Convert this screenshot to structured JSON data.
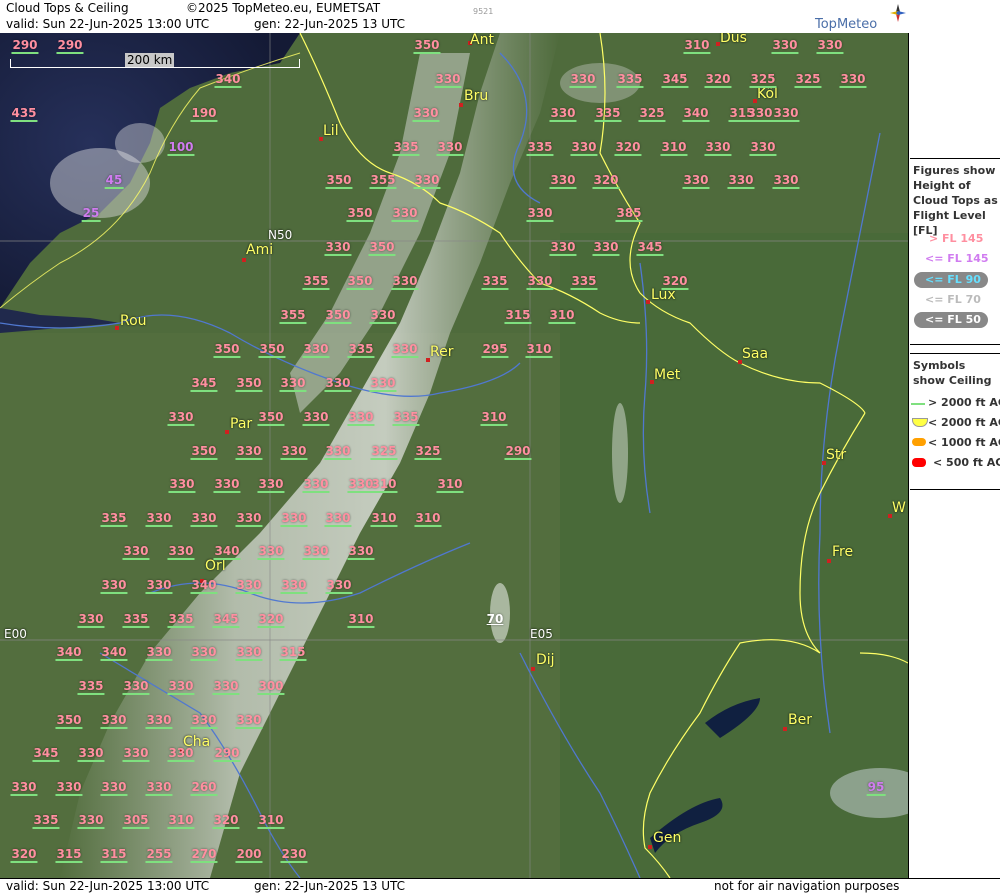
{
  "header": {
    "title": "Cloud Tops & Ceiling",
    "copyright": "©2025 TopMeteo.eu, EUMETSAT",
    "code": "9521",
    "valid": "valid:  Sun  22-Jun-2025  13:00 UTC",
    "gen": "gen: 22-Jun-2025 13 UTC",
    "logo": "TopMeteo"
  },
  "footer": {
    "valid": "valid:  Sun  22-Jun-2025  13:00 UTC",
    "gen": "gen: 22-Jun-2025 13 UTC",
    "disclaimer": "not for air navigation purposes"
  },
  "scale_bar": "200 km",
  "grid_labels": {
    "n50": "N50",
    "e00": "E00",
    "e05": "E05"
  },
  "cities": [
    "Ant",
    "Düs",
    "Bru",
    "Köl",
    "Lil",
    "Ami",
    "Rou",
    "Lux",
    "Rer",
    "Saa",
    "Met",
    "Par",
    "Str",
    "Fre",
    "W",
    "Orl",
    "Dij",
    "Ber",
    "Cha",
    "Gen"
  ],
  "cloud_labels": [
    "290",
    "290",
    "350",
    "310",
    "330",
    "330",
    "330",
    "330",
    "335",
    "345",
    "320",
    "325",
    "325",
    "330",
    "340",
    "435",
    "190",
    "330",
    "330",
    "335",
    "325",
    "340",
    "315",
    "330",
    "330",
    "100",
    "335",
    "330",
    "335",
    "330",
    "320",
    "310",
    "330",
    "330",
    "45",
    "350",
    "355",
    "330",
    "330",
    "320",
    "330",
    "330",
    "25",
    "330",
    "350",
    "330",
    "330",
    "385",
    "330",
    "350",
    "330",
    "330",
    "345",
    "355",
    "350",
    "330",
    "335",
    "330",
    "335",
    "355",
    "320",
    "350",
    "330",
    "330",
    "315",
    "310",
    "350",
    "350",
    "330",
    "335",
    "295",
    "310",
    "345",
    "350",
    "330",
    "330",
    "330",
    "330",
    "350",
    "330",
    "330",
    "335",
    "325",
    "310",
    "350",
    "330",
    "330",
    "330",
    "325",
    "310",
    "290",
    "330",
    "330",
    "330",
    "330",
    "330",
    "310",
    "335",
    "330",
    "330",
    "330",
    "330",
    "330",
    "310",
    "310",
    "330",
    "330",
    "340",
    "330",
    "330",
    "330",
    "330",
    "330",
    "340",
    "330",
    "330",
    "330",
    "330",
    "335",
    "335",
    "345",
    "320",
    "310",
    "70",
    "340",
    "340",
    "330",
    "330",
    "330",
    "315",
    "335",
    "330",
    "330",
    "330",
    "300",
    "350",
    "330",
    "330",
    "330",
    "330",
    "345",
    "330",
    "330",
    "330",
    "290",
    "330",
    "330",
    "330",
    "330",
    "260",
    "335",
    "330",
    "305",
    "310",
    "320",
    "310",
    "95",
    "320",
    "315",
    "315",
    "255",
    "270",
    "200",
    "230"
  ],
  "legend": {
    "figures_title": "Figures show Height of Cloud Tops as Flight Level  [FL]",
    "fl": [
      "> FL 145",
      "<= FL 145",
      "<= FL 90",
      "<= FL 70",
      "<= FL 50"
    ],
    "symbols_title": "Symbols show Ceiling",
    "ceil": [
      "> 2000 ft AGL",
      "< 2000 ft AGL",
      "< 1000 ft AGL",
      "< 500 ft AGL"
    ]
  },
  "colors": {
    "above_145": "#ff8fa0",
    "below_145": "#d07cf0",
    "below_90": "#66e0ff",
    "ceil_high": "#7fe07f",
    "ceil_2000": "#ffff44",
    "ceil_1000": "#ffa000",
    "ceil_500": "#ff0000"
  }
}
